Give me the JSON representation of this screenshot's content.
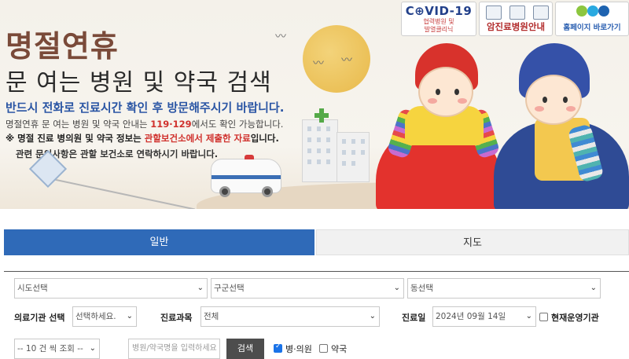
{
  "banner": {
    "title_main": "명절연휴",
    "title_sub": "문 여는 병원 및 약국 검색",
    "notice_blue": "반드시 전화로 진료시간 확인 후 방문해주시기 바랍니다.",
    "notice_1_pre": "명절연휴 문 여는 병원 및 약국 안내는 ",
    "notice_1_red": "119·129",
    "notice_1_post": "에서도 확인 가능합니다.",
    "notice_2_pre": "※ 명절 진료 병의원 및 약국 정보는 ",
    "notice_2_red": "관할보건소에서 제출한 자료",
    "notice_2_post": "입니다.",
    "notice_3": "관련 문의사항은 관할 보건소로 연락하시기 바랍니다."
  },
  "badges": {
    "covid_title": "C⊕VID-19",
    "covid_sub1": "협력병원 및",
    "covid_sub2": "발열클리닉",
    "cancer": "암진료병원안내",
    "home": "홈페이지 바로가기"
  },
  "tabs": [
    {
      "label": "일반",
      "active": true
    },
    {
      "label": "지도",
      "active": false
    }
  ],
  "filters": {
    "sido": "시도선택",
    "gugun": "구군선택",
    "dong": "동선택",
    "org_type_label": "의료기관 선택",
    "org_type_value": "선택하세요.",
    "dept_label": "진료과목",
    "dept_value": "전체",
    "date_label": "진료일",
    "date_value": "2024년 09월 14일",
    "current_open_label": "현재운영기관",
    "page_size": "-- 10 건 씩 조회 --",
    "search_placeholder": "병원/약국명을 입력하세요",
    "search_button": "검색",
    "hospital_label": "병·의원",
    "pharmacy_label": "약국"
  },
  "colors": {
    "accent": "#2f6ab8",
    "title_brown": "#7a4a39",
    "notice_red": "#d0312d",
    "notice_blue": "#2a55a4"
  }
}
